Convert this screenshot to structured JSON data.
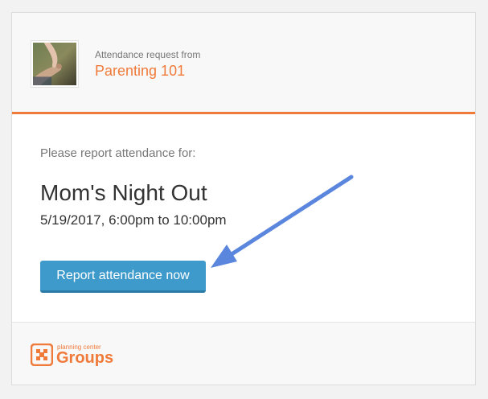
{
  "header": {
    "request_label": "Attendance request from",
    "group_name": "Parenting 101",
    "avatar_icon": "group-photo-icon"
  },
  "main": {
    "prompt": "Please report attendance for:",
    "event_title": "Mom's Night Out",
    "event_time": "5/19/2017, 6:00pm to 10:00pm",
    "report_button_label": "Report attendance now"
  },
  "footer": {
    "logo_small": "planning center",
    "logo_big": "Groups",
    "logo_icon": "planning-center-groups-icon"
  },
  "annotation": {
    "arrow_icon": "arrow-icon"
  },
  "colors": {
    "accent": "#f07a3a",
    "button": "#3d9acb",
    "arrow": "#5b86dd"
  }
}
